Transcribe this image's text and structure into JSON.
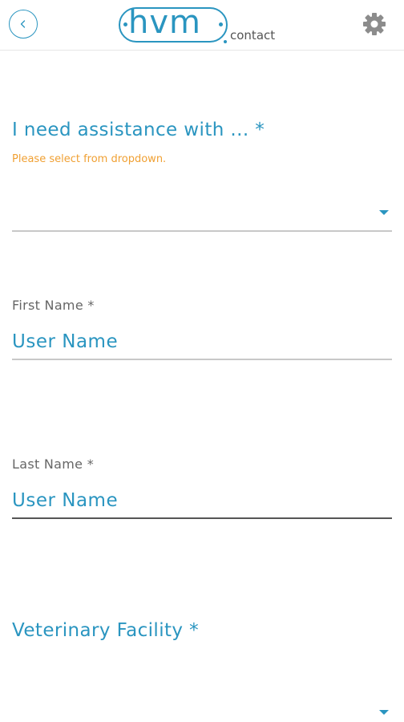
{
  "header": {
    "back_icon": "chevron-left-icon",
    "logo_main": "hvm",
    "logo_sub": "contact",
    "settings_icon": "gear-icon"
  },
  "form": {
    "assistance": {
      "label": "I need assistance with ... *",
      "hint": "Please select from dropdown.",
      "selected_value": ""
    },
    "first_name": {
      "label": "First Name *",
      "value": "User Name"
    },
    "last_name": {
      "label": "Last Name *",
      "value": "User Name"
    },
    "veterinary_facility": {
      "label": "Veterinary Facility *",
      "selected_value": ""
    }
  },
  "colors": {
    "accent": "#2a95c0",
    "hint": "#f0a033",
    "label_gray": "#666666",
    "divider": "#c8c8c8"
  }
}
